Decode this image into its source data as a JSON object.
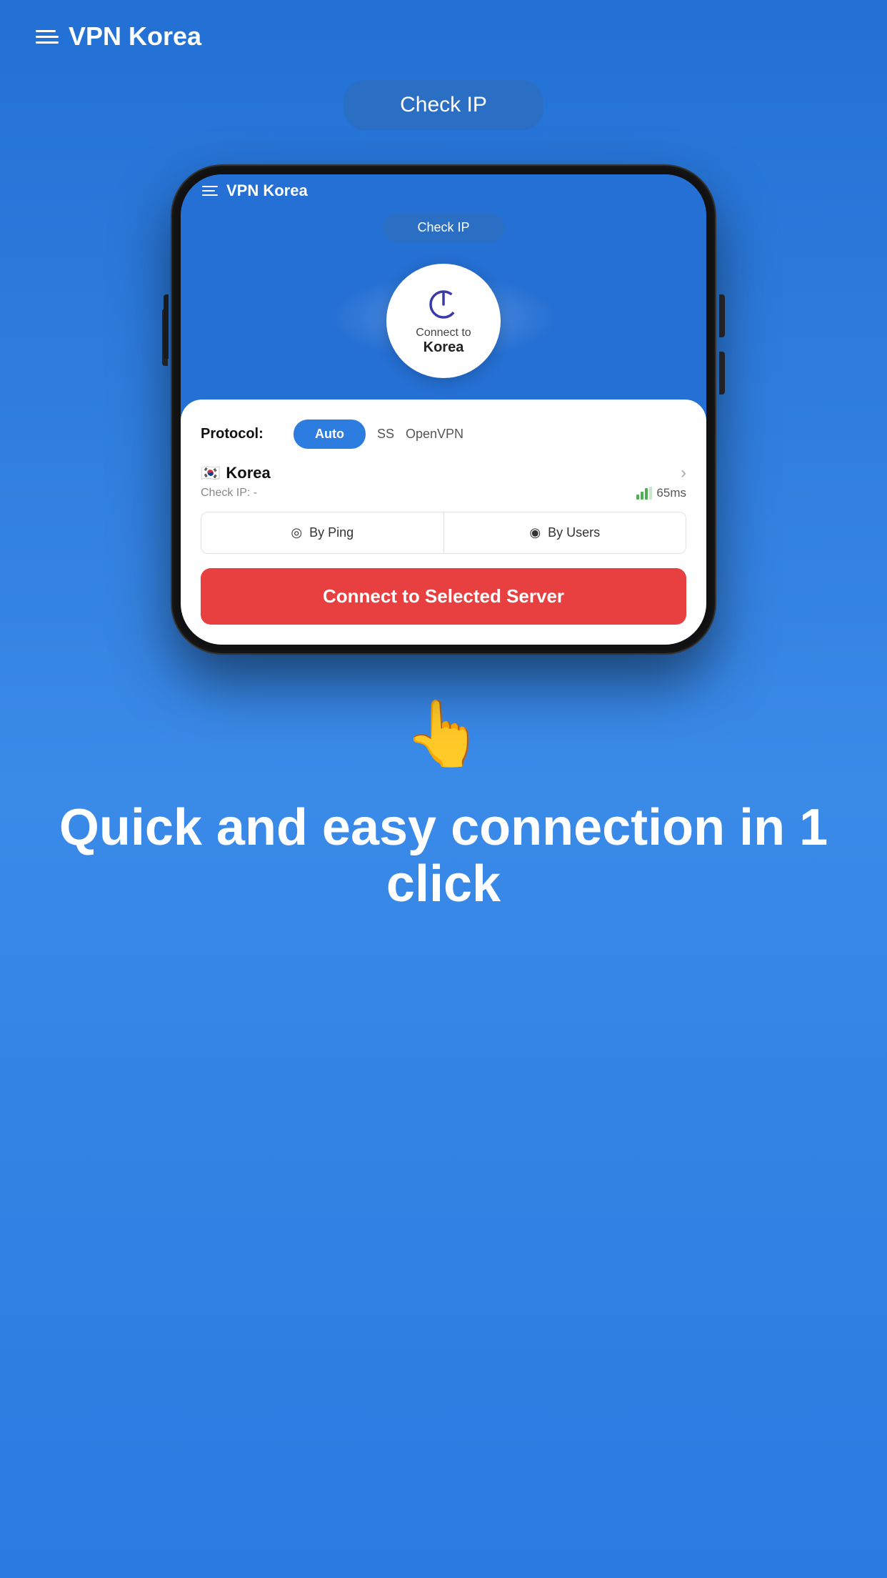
{
  "background_color": "#2d7de0",
  "header": {
    "title": "VPN Korea",
    "menu_icon": "menu-icon"
  },
  "check_ip_button": "Check IP",
  "power_button": {
    "label_top": "Connect to",
    "label_bottom": "Korea"
  },
  "protocol": {
    "label": "Protocol:",
    "options": [
      "Auto",
      "SS",
      "OpenVPN"
    ],
    "selected": "Auto"
  },
  "server": {
    "flag": "🇰🇷",
    "name": "Korea",
    "check_ip_label": "Check IP: -",
    "ping": "65ms"
  },
  "sort_options": {
    "by_ping": "By Ping",
    "by_users": "By Users"
  },
  "connect_button": "Connect to Selected Server",
  "bottom": {
    "emoji": "👆",
    "tagline": "Quick and easy connection in 1 click"
  }
}
